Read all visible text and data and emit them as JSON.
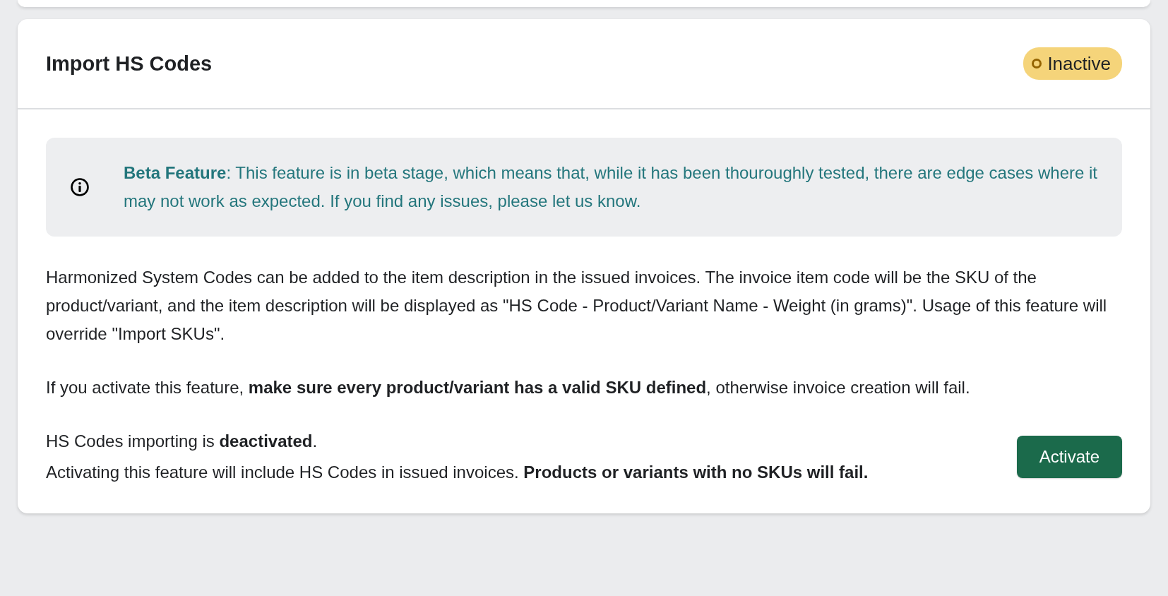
{
  "card": {
    "title": "Import HS Codes",
    "status": {
      "label": "Inactive",
      "active": false
    },
    "notice": {
      "kind": "info",
      "text": "**Beta Feature**: This feature is in beta stage, which means that, while it has been thouroughly tested, there are edge cases where it may not work as expected. If you find any issues, please let us know."
    },
    "paragraphs": [
      "Harmonized System Codes can be added to the item description in the issued invoices. The invoice item code will be the SKU of the product/variant, and the item description will be displayed as \"HS Code - Product/Variant Name - Weight (in grams)\". Usage of this feature will override \"Import SKUs\".",
      "If you activate this feature, **make sure every product/variant has a valid SKU defined**, otherwise invoice creation will fail."
    ],
    "state_line": "HS Codes importing is **deactivated**.",
    "action_note": "Activating this feature will include HS Codes in issued invoices. **Products or variants with no SKUs will fail.**",
    "button": "Activate"
  }
}
